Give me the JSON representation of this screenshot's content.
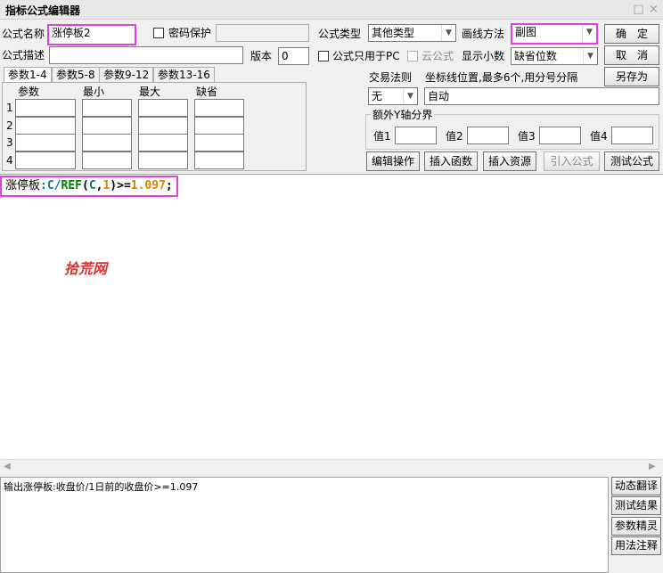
{
  "window": {
    "title": "指标公式编辑器",
    "maximize_icon": "□",
    "close_icon": "×"
  },
  "form": {
    "name_label": "公式名称",
    "name_value": "涨停板2",
    "password_label": "密码保护",
    "type_label": "公式类型",
    "type_value": "其他类型",
    "draw_label": "画线方法",
    "draw_value": "副图",
    "desc_label": "公式描述",
    "desc_value": "",
    "version_label": "版本",
    "version_value": "0",
    "pc_only_label": "公式只用于PC",
    "cloud_label": "云公式",
    "decimals_label": "显示小数",
    "decimals_value": "缺省位数"
  },
  "buttons": {
    "ok": "确　定",
    "cancel": "取　消",
    "save_as": "另存为",
    "edit_ops": "编辑操作",
    "insert_func": "插入函数",
    "insert_res": "插入资源",
    "import_formula": "引入公式",
    "test_formula": "测试公式"
  },
  "params": {
    "tabs": [
      "参数1-4",
      "参数5-8",
      "参数9-12",
      "参数13-16"
    ],
    "headers": [
      "参数",
      "最小",
      "最大",
      "缺省"
    ],
    "rows": [
      "1",
      "2",
      "3",
      "4"
    ]
  },
  "trade": {
    "rule_label": "交易法则",
    "rule_value": "无",
    "coord_label": "坐标线位置,最多6个,用分号分隔",
    "coord_value": "自动",
    "yaxis_group": "额外Y轴分界",
    "values": [
      "值1",
      "值2",
      "值3",
      "值4"
    ]
  },
  "code": {
    "name": "涨停板",
    "colon": ":",
    "c1": "C",
    "slash": "/",
    "ref": "REF",
    "lparen": "(",
    "c2": "C",
    "comma": ",",
    "one": "1",
    "rparen": ")",
    "op": ">=",
    "num": "1.097",
    "semi": ";"
  },
  "watermark": "拾荒网",
  "output": {
    "text": "输出涨停板:收盘价/1日前的收盘价>=1.097"
  },
  "side_buttons": [
    "动态翻译",
    "测试结果",
    "参数精灵",
    "用法注释"
  ],
  "colors": {
    "highlight": "#e040e0",
    "code_name": "#000000",
    "code_var": "#008080",
    "code_func": "#008000",
    "code_number": "#e08000",
    "watermark": "#e03030"
  }
}
